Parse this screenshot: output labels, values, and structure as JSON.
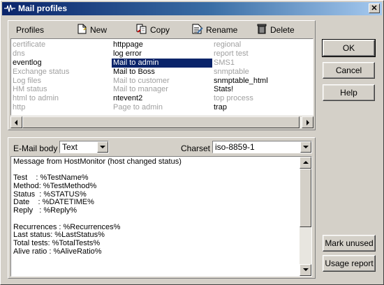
{
  "window": {
    "title": "Mail profiles",
    "close_glyph": "✕"
  },
  "toolbar": {
    "profiles_label": "Profiles",
    "new_label": "New",
    "copy_label": "Copy",
    "rename_label": "Rename",
    "delete_label": "Delete"
  },
  "profiles": {
    "columns": [
      [
        {
          "name": "certificate",
          "used": false
        },
        {
          "name": "dns",
          "used": false
        },
        {
          "name": "eventlog",
          "used": true
        },
        {
          "name": "Exchange status",
          "used": false
        },
        {
          "name": "Log files",
          "used": false
        },
        {
          "name": "HM status",
          "used": false
        },
        {
          "name": "html to admin",
          "used": false
        },
        {
          "name": "http",
          "used": false
        }
      ],
      [
        {
          "name": "httppage",
          "used": true
        },
        {
          "name": "log error",
          "used": true
        },
        {
          "name": "Mail to admin",
          "used": true,
          "selected": true
        },
        {
          "name": "Mail to Boss",
          "used": true
        },
        {
          "name": "Mail to customer",
          "used": false
        },
        {
          "name": "Mail to manager",
          "used": false
        },
        {
          "name": "ntevent2",
          "used": true
        },
        {
          "name": "Page to admin",
          "used": false
        }
      ],
      [
        {
          "name": "regional",
          "used": false
        },
        {
          "name": "report test",
          "used": false
        },
        {
          "name": "SMS1",
          "used": false
        },
        {
          "name": "snmptable",
          "used": false
        },
        {
          "name": "snmptable_html",
          "used": true
        },
        {
          "name": "Stats!",
          "used": true
        },
        {
          "name": "top process",
          "used": false
        },
        {
          "name": "trap",
          "used": true
        }
      ]
    ]
  },
  "buttons": {
    "ok": "OK",
    "cancel": "Cancel",
    "help": "Help",
    "mark_unused": "Mark unused",
    "usage_report": "Usage report"
  },
  "email_body": {
    "label": "E-Mail body",
    "format_value": "Text",
    "charset_label": "Charset",
    "charset_value": "iso-8859-1",
    "lines": [
      "Message from HostMonitor (host changed status)",
      "",
      "Test    : %TestName%",
      "Method: %TestMethod%",
      "Status  : %STATUS%",
      "Date    : %DATETIME%",
      "Reply   : %Reply%",
      "",
      "Recurrences : %Recurrences%",
      "Last status: %LastStatus%",
      "Total tests: %TotalTests%",
      "Alive ratio : %AliveRatio%"
    ]
  },
  "icons": {
    "title": "pulse-icon",
    "new": "new-document-icon",
    "copy": "copy-icon",
    "rename": "rename-icon",
    "delete": "trash-icon"
  },
  "colors": {
    "selection": "#0a246a",
    "unused_text": "#a0a0a0",
    "face": "#d4d0c8"
  }
}
